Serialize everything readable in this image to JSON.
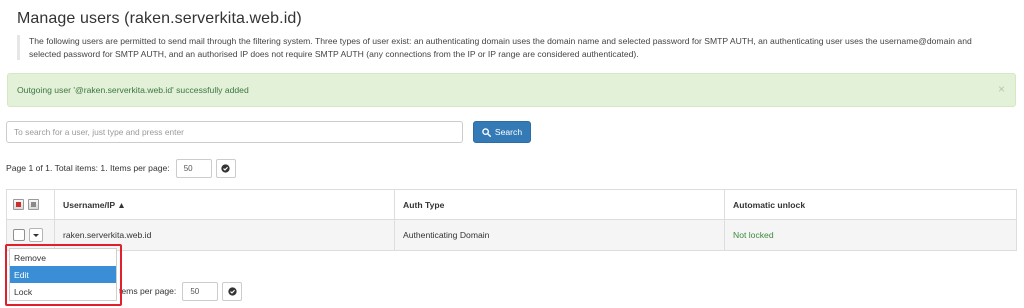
{
  "page": {
    "title": "Manage users (raken.serverkita.web.id)",
    "description": "The following users are permitted to send mail through the filtering system. Three types of user exist: an authenticating domain uses the domain name and selected password for SMTP AUTH, an authenticating user uses the username@domain and selected password for SMTP AUTH, and an authorised IP does not require SMTP AUTH (any connections from the IP or IP range are considered authenticated)."
  },
  "alert": {
    "message": "Outgoing user '@raken.serverkita.web.id' successfully added",
    "close_glyph": "×"
  },
  "search": {
    "placeholder": "To search for a user, just type and press enter",
    "value": "",
    "button_label": "Search",
    "button_icon": "search-icon"
  },
  "pagination": {
    "summary": "Page 1 of 1. Total items: 1. Items per page:",
    "summary_bottom_visible": "tems per page:",
    "items_per_page": "50"
  },
  "table": {
    "columns": [
      {
        "label": "Username/IP ▲"
      },
      {
        "label": "Auth Type"
      },
      {
        "label": "Automatic unlock"
      }
    ],
    "rows": [
      {
        "username": "raken.serverkita.web.id",
        "auth_type": "Authenticating Domain",
        "automatic_unlock": "Not locked"
      }
    ]
  },
  "row_menu": {
    "items": [
      {
        "label": "Remove",
        "active": false
      },
      {
        "label": "Edit",
        "active": true
      },
      {
        "label": "Lock",
        "active": false
      }
    ]
  },
  "colors": {
    "primary": "#337ab7",
    "success_bg": "#e3f1d9",
    "success_text": "#3c763d",
    "menu_active": "#3a8ed6",
    "highlight": "#e0212b"
  }
}
